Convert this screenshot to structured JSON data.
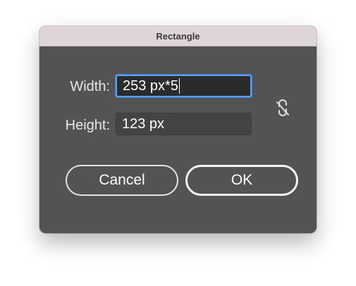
{
  "dialog": {
    "title": "Rectangle",
    "width_label": "Width:",
    "width_value": "253 px*5",
    "height_label": "Height:",
    "height_value": "123 px",
    "link_icon": "unlink-icon",
    "cancel_label": "Cancel",
    "ok_label": "OK"
  },
  "colors": {
    "dialog_bg": "#535353",
    "titlebar_bg": "#ded6d6",
    "focus_ring": "#5aa2ff"
  }
}
